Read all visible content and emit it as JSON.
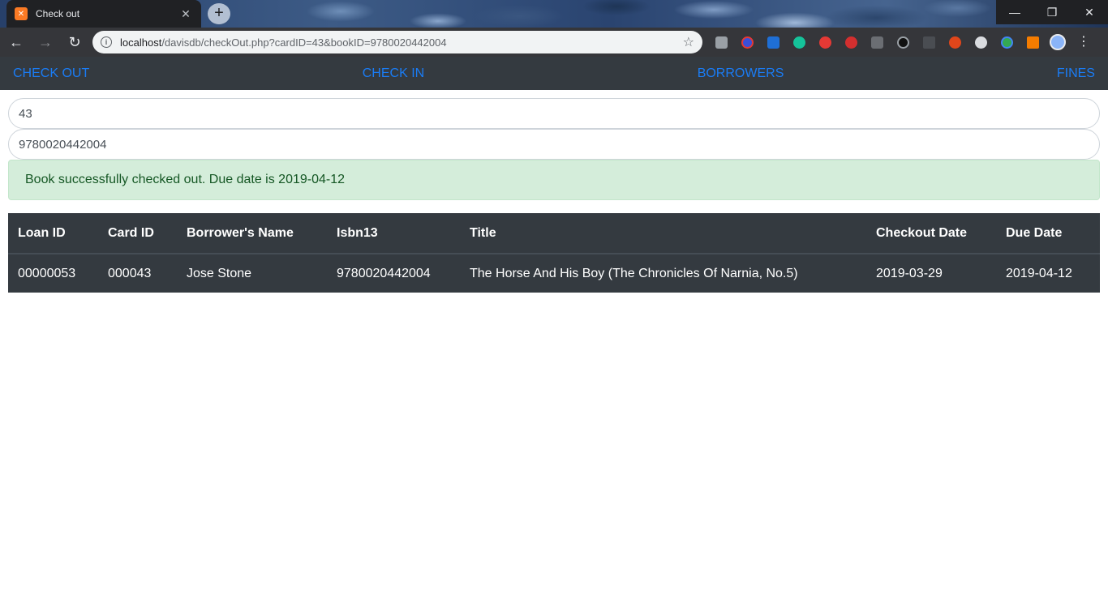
{
  "browser": {
    "tab_title": "Check out",
    "favicon_icon": "xampp-icon",
    "url_host": "localhost",
    "url_path": "/davisdb/checkOut.php?cardID=43&bookID=9780020442004"
  },
  "nav": {
    "items": [
      {
        "label": "CHECK OUT"
      },
      {
        "label": "CHECK IN"
      },
      {
        "label": "BORROWERS"
      },
      {
        "label": "FINES"
      }
    ]
  },
  "form": {
    "card_id_value": "43",
    "book_id_value": "9780020442004"
  },
  "alert": {
    "message": "Book successfully checked out. Due date is 2019-04-12"
  },
  "table": {
    "headers": [
      "Loan ID",
      "Card ID",
      "Borrower's Name",
      "Isbn13",
      "Title",
      "Checkout Date",
      "Due Date"
    ],
    "rows": [
      [
        "00000053",
        "000043",
        "Jose Stone",
        "9780020442004",
        "The Horse And His Boy (The Chronicles Of Narnia, No.5)",
        "2019-03-29",
        "2019-04-12"
      ]
    ]
  },
  "colors": {
    "nav_background": "#343a40",
    "link": "#1a7cf5",
    "alert_background": "#d4edda",
    "alert_text": "#155724"
  }
}
